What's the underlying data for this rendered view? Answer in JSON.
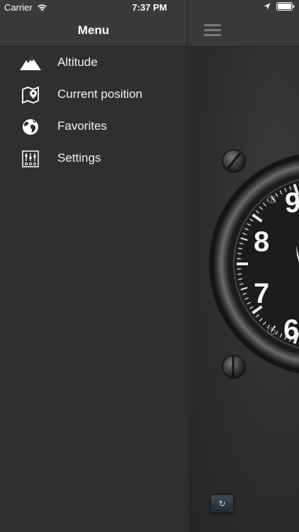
{
  "status": {
    "carrier": "Carrier",
    "time": "7:37 PM"
  },
  "menu": {
    "title": "Menu",
    "items": [
      {
        "label": "Altitude",
        "icon": "mountain-icon"
      },
      {
        "label": "Current position",
        "icon": "map-pin-icon"
      },
      {
        "label": "Favorites",
        "icon": "globe-icon"
      },
      {
        "label": "Settings",
        "icon": "sliders-icon"
      }
    ]
  },
  "gauge": {
    "digits": [
      "9",
      "8",
      "7",
      "6"
    ]
  },
  "refresh": {
    "icon": "refresh-icon"
  }
}
